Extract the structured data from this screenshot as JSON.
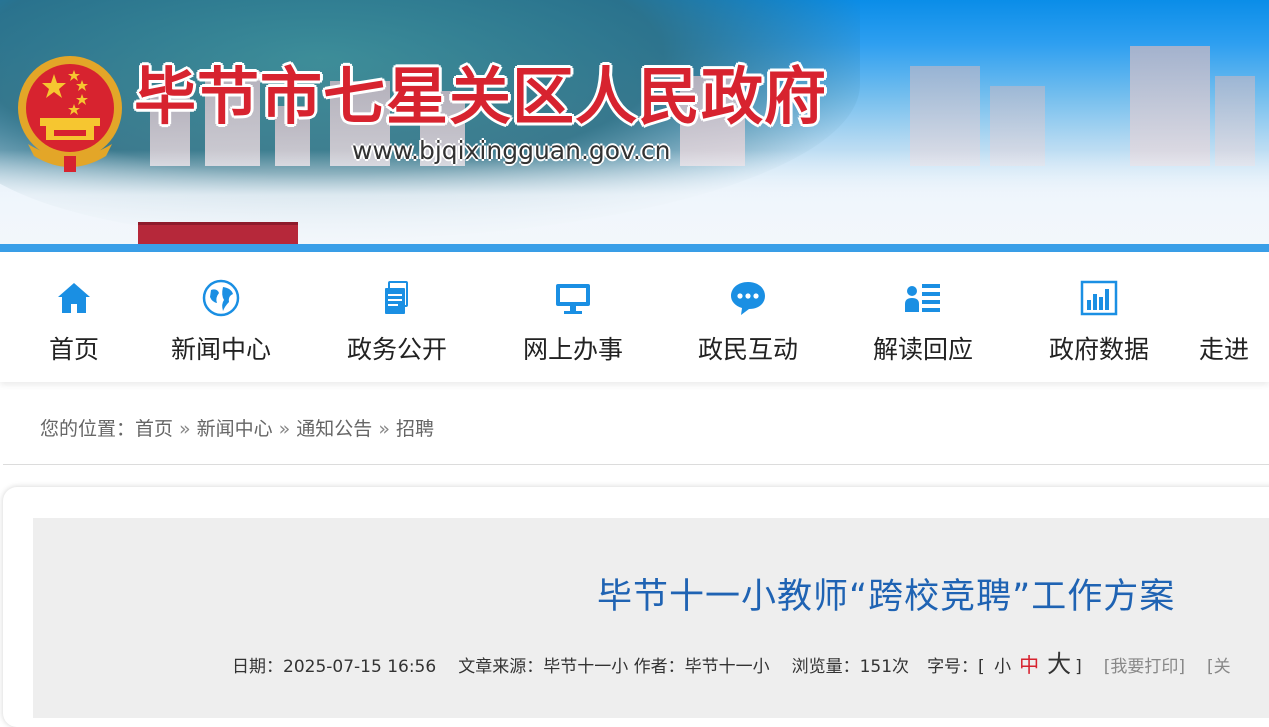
{
  "header": {
    "site_title": "毕节市七星关区人民政府",
    "site_url": "www.bjqixingguan.gov.cn",
    "emblem_icon": "national-emblem-icon"
  },
  "nav": {
    "items": [
      {
        "label": "首页",
        "icon": "home-icon"
      },
      {
        "label": "新闻中心",
        "icon": "globe-icon"
      },
      {
        "label": "政务公开",
        "icon": "document-icon"
      },
      {
        "label": "网上办事",
        "icon": "monitor-icon"
      },
      {
        "label": "政民互动",
        "icon": "chat-icon"
      },
      {
        "label": "解读回应",
        "icon": "user-list-icon"
      },
      {
        "label": "政府数据",
        "icon": "bar-chart-icon"
      },
      {
        "label": "走进"
      }
    ],
    "icon_color": "#1a8fe3"
  },
  "breadcrumb": {
    "prefix": "您的位置：",
    "items": [
      "首页",
      "新闻中心",
      "通知公告",
      "招聘"
    ],
    "separator": "»"
  },
  "article": {
    "title": "毕节十一小教师“跨校竞聘”工作方案",
    "date": "日期：2025-07-15 16:56",
    "source": "文章来源：毕节十一小",
    "author": "作者：毕节十一小",
    "views": "浏览量：151次",
    "font_size_label": "字号：[",
    "font_small": "小",
    "font_medium": "中",
    "font_large": "大",
    "font_close": "]",
    "print": "[我要打印]",
    "close": "[关"
  },
  "colors": {
    "title_red": "#d7232f",
    "article_title_blue": "#1f63b3",
    "banner_blue": "#3a9fe8"
  }
}
